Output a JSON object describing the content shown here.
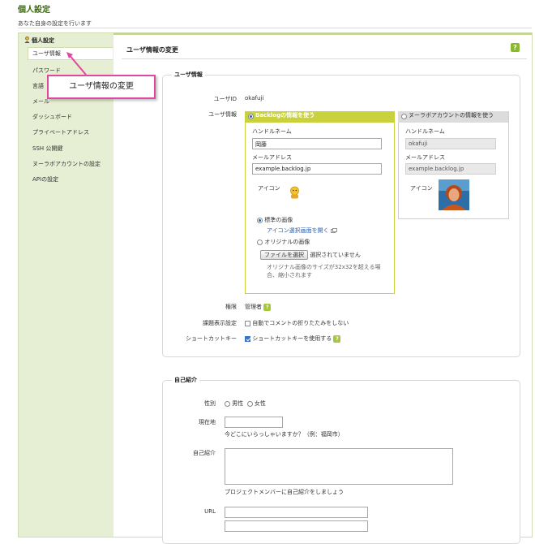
{
  "page": {
    "title": "個人設定",
    "subtitle": "あなた自身の設定を行います"
  },
  "sidebar": {
    "header": "個人設定",
    "items": [
      {
        "label": "ユーザ情報",
        "active": true
      },
      {
        "label": "パスワード"
      },
      {
        "label": "言語"
      },
      {
        "label": "メール"
      },
      {
        "label": "ダッシュボード"
      },
      {
        "label": "プライベートアドレス"
      },
      {
        "label": "SSH 公開鍵"
      },
      {
        "label": "ヌーラボアカウントの設定"
      },
      {
        "label": "APIの設定"
      }
    ]
  },
  "callout": {
    "text": "ユーザ情報の変更"
  },
  "main": {
    "title": "ユーザ情報の変更",
    "help": "?",
    "user_info": {
      "legend": "ユーザ情報",
      "userid_label": "ユーザID",
      "userid_value": "okafuji",
      "userinfo_label": "ユーザ情報",
      "backlog_panel": {
        "option_label": "Backlogの情報を使う",
        "handle_label": "ハンドルネーム",
        "handle_value": "岡藤",
        "mail_label": "メールアドレス",
        "mail_value": "example.backlog.jp",
        "icon_label": "アイコン",
        "std_image_label": "標準の画像",
        "open_icon_link": "アイコン選択画面を開く",
        "orig_image_label": "オリジナルの画像",
        "file_button": "ファイルを選択",
        "file_status": "選択されていません",
        "note_line1": "オリジナル画像のサイズが32x32を超える場",
        "note_line2": "合、縮小されます"
      },
      "nulab_panel": {
        "option_label": "ヌーラボアカウントの情報を使う",
        "handle_label": "ハンドルネーム",
        "handle_value": "okafuji",
        "mail_label": "メールアドレス",
        "mail_value": "example.backlog.jp",
        "icon_label": "アイコン"
      },
      "role_label": "権限",
      "role_value": "管理者",
      "display_label": "課題表示設定",
      "display_option": "自動でコメントの折りたたみをしない",
      "shortcut_label": "ショートカットキー",
      "shortcut_option": "ショートカットキーを使用する"
    },
    "profile": {
      "legend": "自己紹介",
      "gender_label": "性別",
      "male": "男性",
      "female": "女性",
      "location_label": "現在地",
      "location_hint": "今どこにいらっしゃいますか？（例：福岡市）",
      "intro_label": "自己紹介",
      "intro_hint": "プロジェクトメンバーに自己紹介をしましょう",
      "url_label": "URL"
    }
  },
  "colors": {
    "accent_green": "#8ab82e",
    "panel_yellow": "#c9d13c",
    "callout_pink": "#e0479e",
    "link_blue": "#2a5db0"
  }
}
